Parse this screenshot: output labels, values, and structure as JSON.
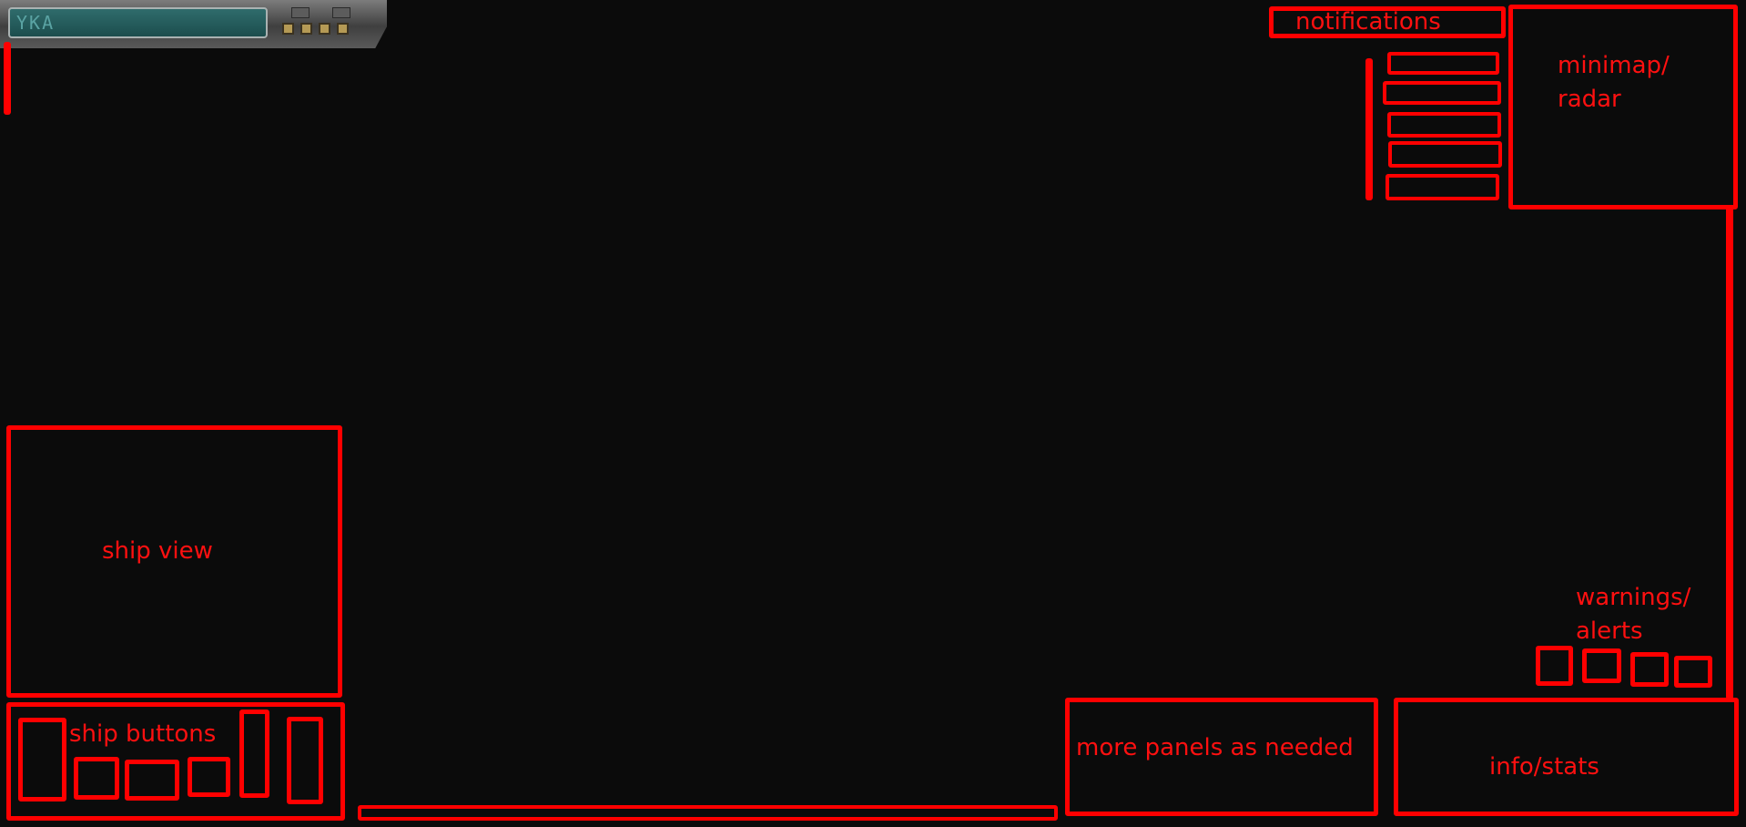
{
  "console": {
    "readout": "YKA"
  },
  "labels": {
    "notifications": "notifications",
    "minimap": "minimap/\nradar",
    "ship_view": "ship view",
    "ship_buttons": "ship buttons",
    "more_panels": "more panels as needed",
    "info_stats": "info/stats",
    "warnings": "warnings/\nalerts"
  },
  "colors": {
    "wireframe": "#ff0000",
    "background": "#0b0b0b"
  }
}
